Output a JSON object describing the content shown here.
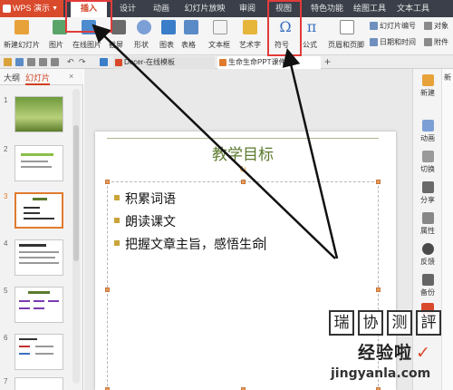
{
  "app": {
    "name": "WPS 演示"
  },
  "menu_tabs": [
    "插入",
    "设计",
    "动画",
    "幻灯片放映",
    "审阅",
    "视图",
    "特色功能",
    "绘图工具",
    "文本工具"
  ],
  "ribbon": {
    "new_slide": "新建幻灯片",
    "picture": "图片",
    "online_picture": "在线图片",
    "screenshot": "截屏",
    "shape": "形状",
    "chart": "图表",
    "table": "表格",
    "textbox": "文本框",
    "art": "艺术字",
    "symbol": "符号",
    "formula": "公式",
    "header_footer": "页眉和页脚",
    "slide_number": "幻灯片编号",
    "datetime": "日期和时间",
    "object": "对象",
    "attachment": "附件"
  },
  "doc_tabs": [
    {
      "label": "Docer-在线模板"
    },
    {
      "label": "生命生命PPT课件..."
    }
  ],
  "panel_tabs": {
    "outline": "大纲",
    "slides": "幻灯片"
  },
  "thumbs": [
    {
      "num": "1"
    },
    {
      "num": "2"
    },
    {
      "num": "3"
    },
    {
      "num": "4"
    },
    {
      "num": "5"
    },
    {
      "num": "6"
    },
    {
      "num": "7"
    }
  ],
  "slide": {
    "title": "教学目标",
    "bullets": [
      "积累词语",
      "朗读课文",
      "把握文章主旨，感悟生命"
    ]
  },
  "right_sidebar": [
    "新建",
    "动画",
    "切换",
    "分享",
    "属性",
    "反馈",
    "备份"
  ],
  "right_edge_label": "新",
  "watermark": {
    "chars": [
      "瑞",
      "协",
      "测",
      "評"
    ],
    "title": "经验啦",
    "check": "✓",
    "url": "jingyanla.com"
  },
  "colors": {
    "tabbar": "#3a3f49",
    "wps_red": "#d94a2c",
    "annotation_red": "#e23b3b",
    "title_green": "#5b7a2e",
    "bullet_gold": "#c9a43a",
    "selection_orange": "#e07b2e"
  }
}
